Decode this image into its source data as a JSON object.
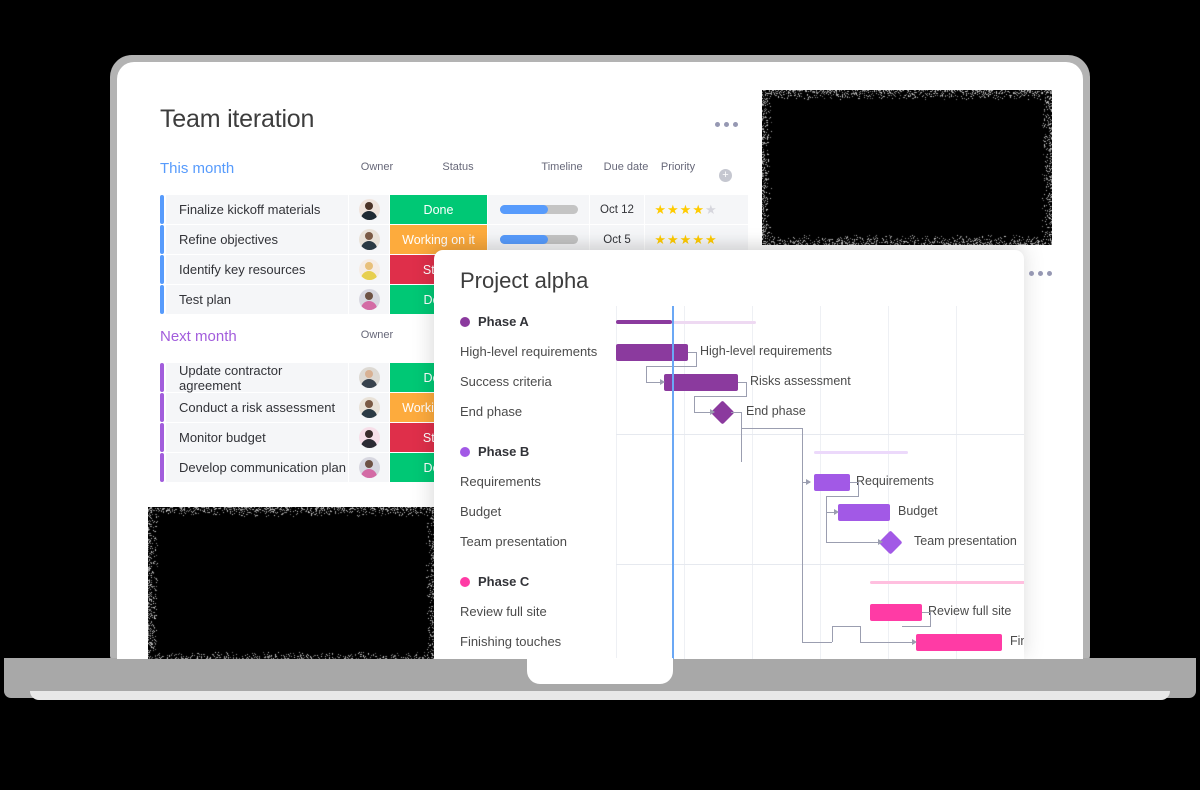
{
  "board": {
    "title": "Team iteration",
    "kebab_label": "•••",
    "columns": {
      "owner": "Owner",
      "status": "Status",
      "timeline": "Timeline",
      "due_date": "Due date",
      "priority": "Priority",
      "add": "+"
    },
    "groups": [
      {
        "name": "This month",
        "accent": "#579bfc",
        "items": [
          {
            "name": "Finalize kickoff materials",
            "owner": "avatar-1",
            "status": "Done",
            "status_color": "#00c875",
            "timeline_pct": 62,
            "due_date": "Oct 12",
            "priority": 4
          },
          {
            "name": "Refine objectives",
            "owner": "avatar-2",
            "status": "Working on it",
            "status_color": "#fdab3d",
            "timeline_pct": 62,
            "due_date": "Oct 5",
            "priority": 5
          },
          {
            "name": "Identify key resources",
            "owner": "avatar-3",
            "status": "Stuck",
            "status_color": "#df2f4a",
            "timeline_pct": 0,
            "due_date": "",
            "priority": 0
          },
          {
            "name": "Test plan",
            "owner": "avatar-4",
            "status": "Done",
            "status_color": "#00c875",
            "timeline_pct": 0,
            "due_date": "",
            "priority": 0
          }
        ]
      },
      {
        "name": "Next month",
        "accent": "#a25ddc",
        "items": [
          {
            "name": "Update contractor agreement",
            "owner": "avatar-5",
            "status": "Done",
            "status_color": "#00c875",
            "timeline_pct": 0,
            "due_date": "",
            "priority": 0
          },
          {
            "name": "Conduct a risk assessment",
            "owner": "avatar-2",
            "status": "Working on it",
            "status_color": "#fdab3d",
            "timeline_pct": 0,
            "due_date": "",
            "priority": 0
          },
          {
            "name": "Monitor budget",
            "owner": "avatar-6",
            "status": "Stuck",
            "status_color": "#df2f4a",
            "timeline_pct": 0,
            "due_date": "",
            "priority": 0
          },
          {
            "name": "Develop communication plan",
            "owner": "avatar-4",
            "status": "Done",
            "status_color": "#00c875",
            "timeline_pct": 0,
            "due_date": "",
            "priority": 0
          }
        ]
      }
    ]
  },
  "gantt": {
    "title": "Project alpha",
    "kebab_label": "•••",
    "phases": [
      {
        "name": "Phase A",
        "color": "#8b3a9e",
        "summary_color": "#eed9f2",
        "tasks": [
          {
            "name": "High-level requirements",
            "bar_label": "High-level requirements",
            "type": "bar"
          },
          {
            "name": "Success criteria",
            "bar_label": "Risks assessment",
            "type": "bar"
          },
          {
            "name": "End phase",
            "bar_label": "End phase",
            "type": "milestone"
          }
        ]
      },
      {
        "name": "Phase B",
        "color": "#a259e6",
        "summary_color": "#ecd9fb",
        "tasks": [
          {
            "name": "Requirements",
            "bar_label": "Requirements",
            "type": "bar"
          },
          {
            "name": "Budget",
            "bar_label": "Budget",
            "type": "bar"
          },
          {
            "name": "Team presentation",
            "bar_label": "Team presentation",
            "type": "milestone"
          }
        ]
      },
      {
        "name": "Phase C",
        "color": "#ff3ba5",
        "summary_color": "#ffbfdf",
        "tasks": [
          {
            "name": "Review full site",
            "bar_label": "Review full site",
            "type": "bar"
          },
          {
            "name": "Finishing touches",
            "bar_label": "Finishing",
            "type": "bar"
          }
        ]
      }
    ],
    "today_marker_color": "#6ba8f5"
  }
}
